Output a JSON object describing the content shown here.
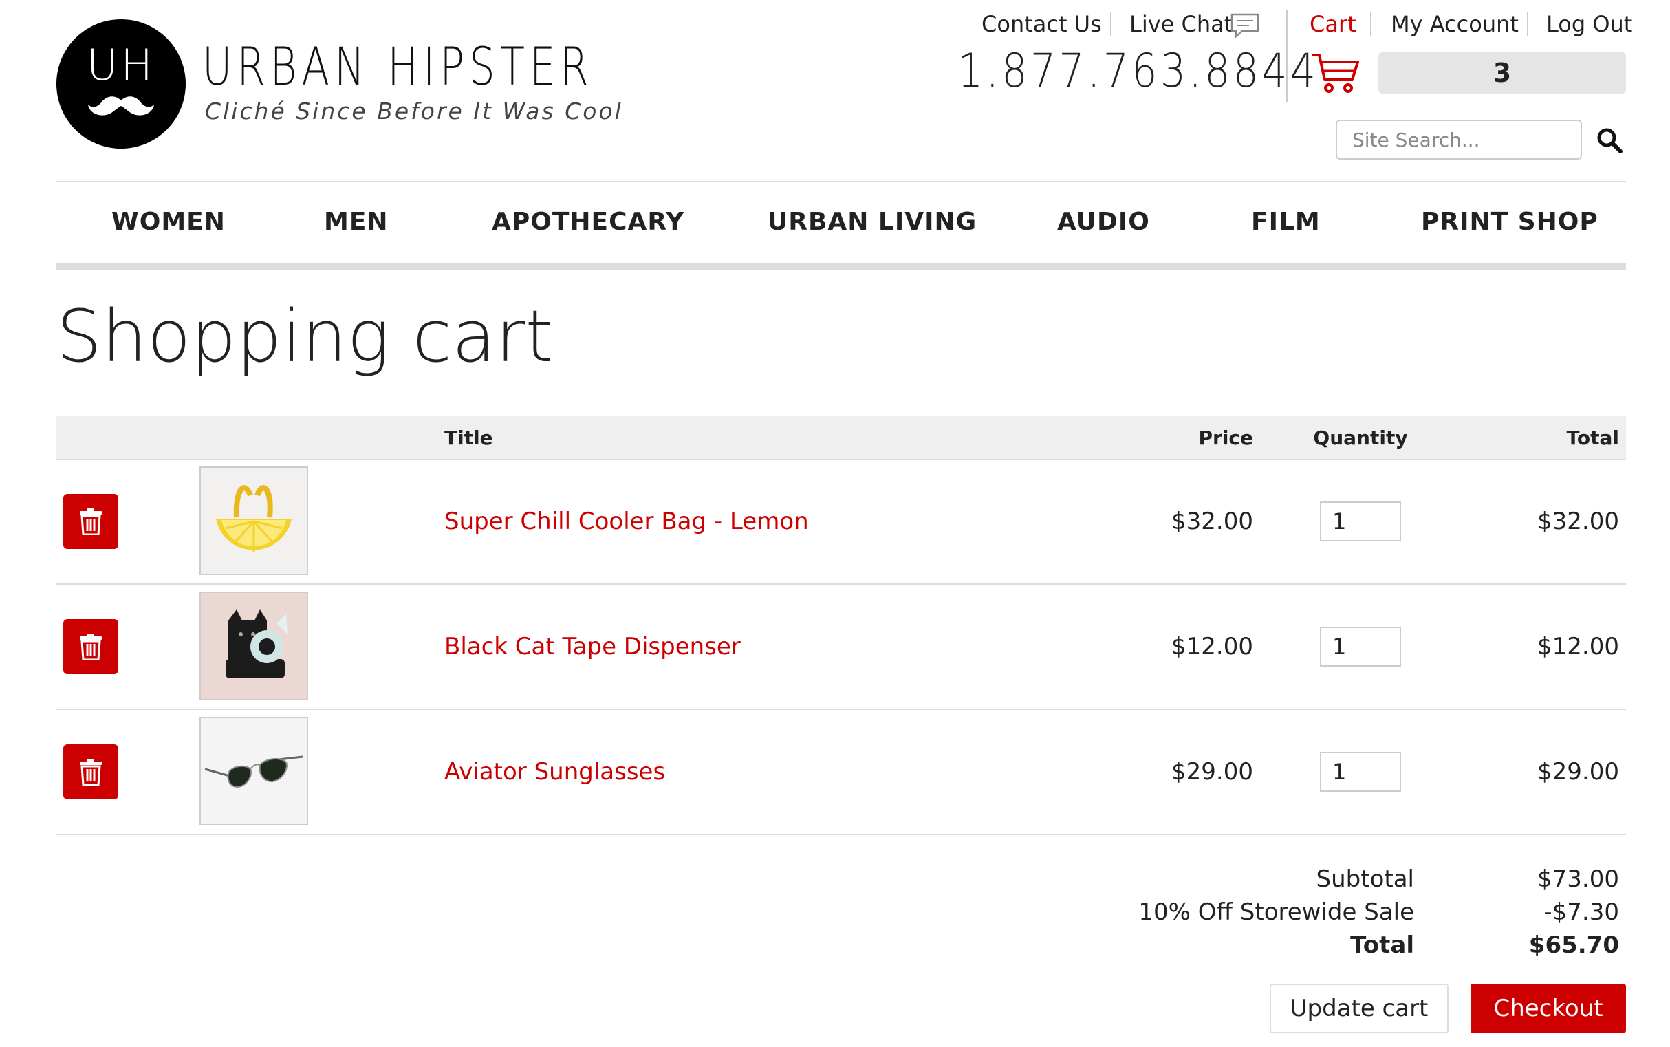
{
  "brand": {
    "initials": "UH",
    "name": "URBAN HIPSTER",
    "tagline": "Cliché Since Before It Was Cool"
  },
  "header": {
    "contact_us": "Contact Us",
    "live_chat": "Live Chat",
    "phone": "1.877.763.8844",
    "cart": "Cart",
    "my_account": "My Account",
    "log_out": "Log Out",
    "cart_count": "3",
    "search_placeholder": "Site Search..."
  },
  "nav": [
    "WOMEN",
    "MEN",
    "APOTHECARY",
    "URBAN LIVING",
    "AUDIO",
    "FILM",
    "PRINT SHOP"
  ],
  "page_title": "Shopping cart",
  "table": {
    "headers": {
      "title": "Title",
      "price": "Price",
      "quantity": "Quantity",
      "total": "Total"
    },
    "rows": [
      {
        "title": "Super Chill Cooler Bag - Lemon",
        "price": "$32.00",
        "quantity": "1",
        "total": "$32.00"
      },
      {
        "title": "Black Cat Tape Dispenser",
        "price": "$12.00",
        "quantity": "1",
        "total": "$12.00"
      },
      {
        "title": "Aviator Sunglasses",
        "price": "$29.00",
        "quantity": "1",
        "total": "$29.00"
      }
    ]
  },
  "summary": {
    "subtotal_label": "Subtotal",
    "subtotal": "$73.00",
    "discount_label": "10% Off Storewide Sale",
    "discount": "-$7.30",
    "total_label": "Total",
    "total": "$65.70"
  },
  "buttons": {
    "update": "Update cart",
    "checkout": "Checkout"
  },
  "colors": {
    "accent": "#cc0000",
    "nav_rule": "#dddddd",
    "table_header": "#efefef"
  },
  "icons": [
    "mustache-icon",
    "chat-icon",
    "cart-icon",
    "search-icon",
    "trash-icon"
  ]
}
